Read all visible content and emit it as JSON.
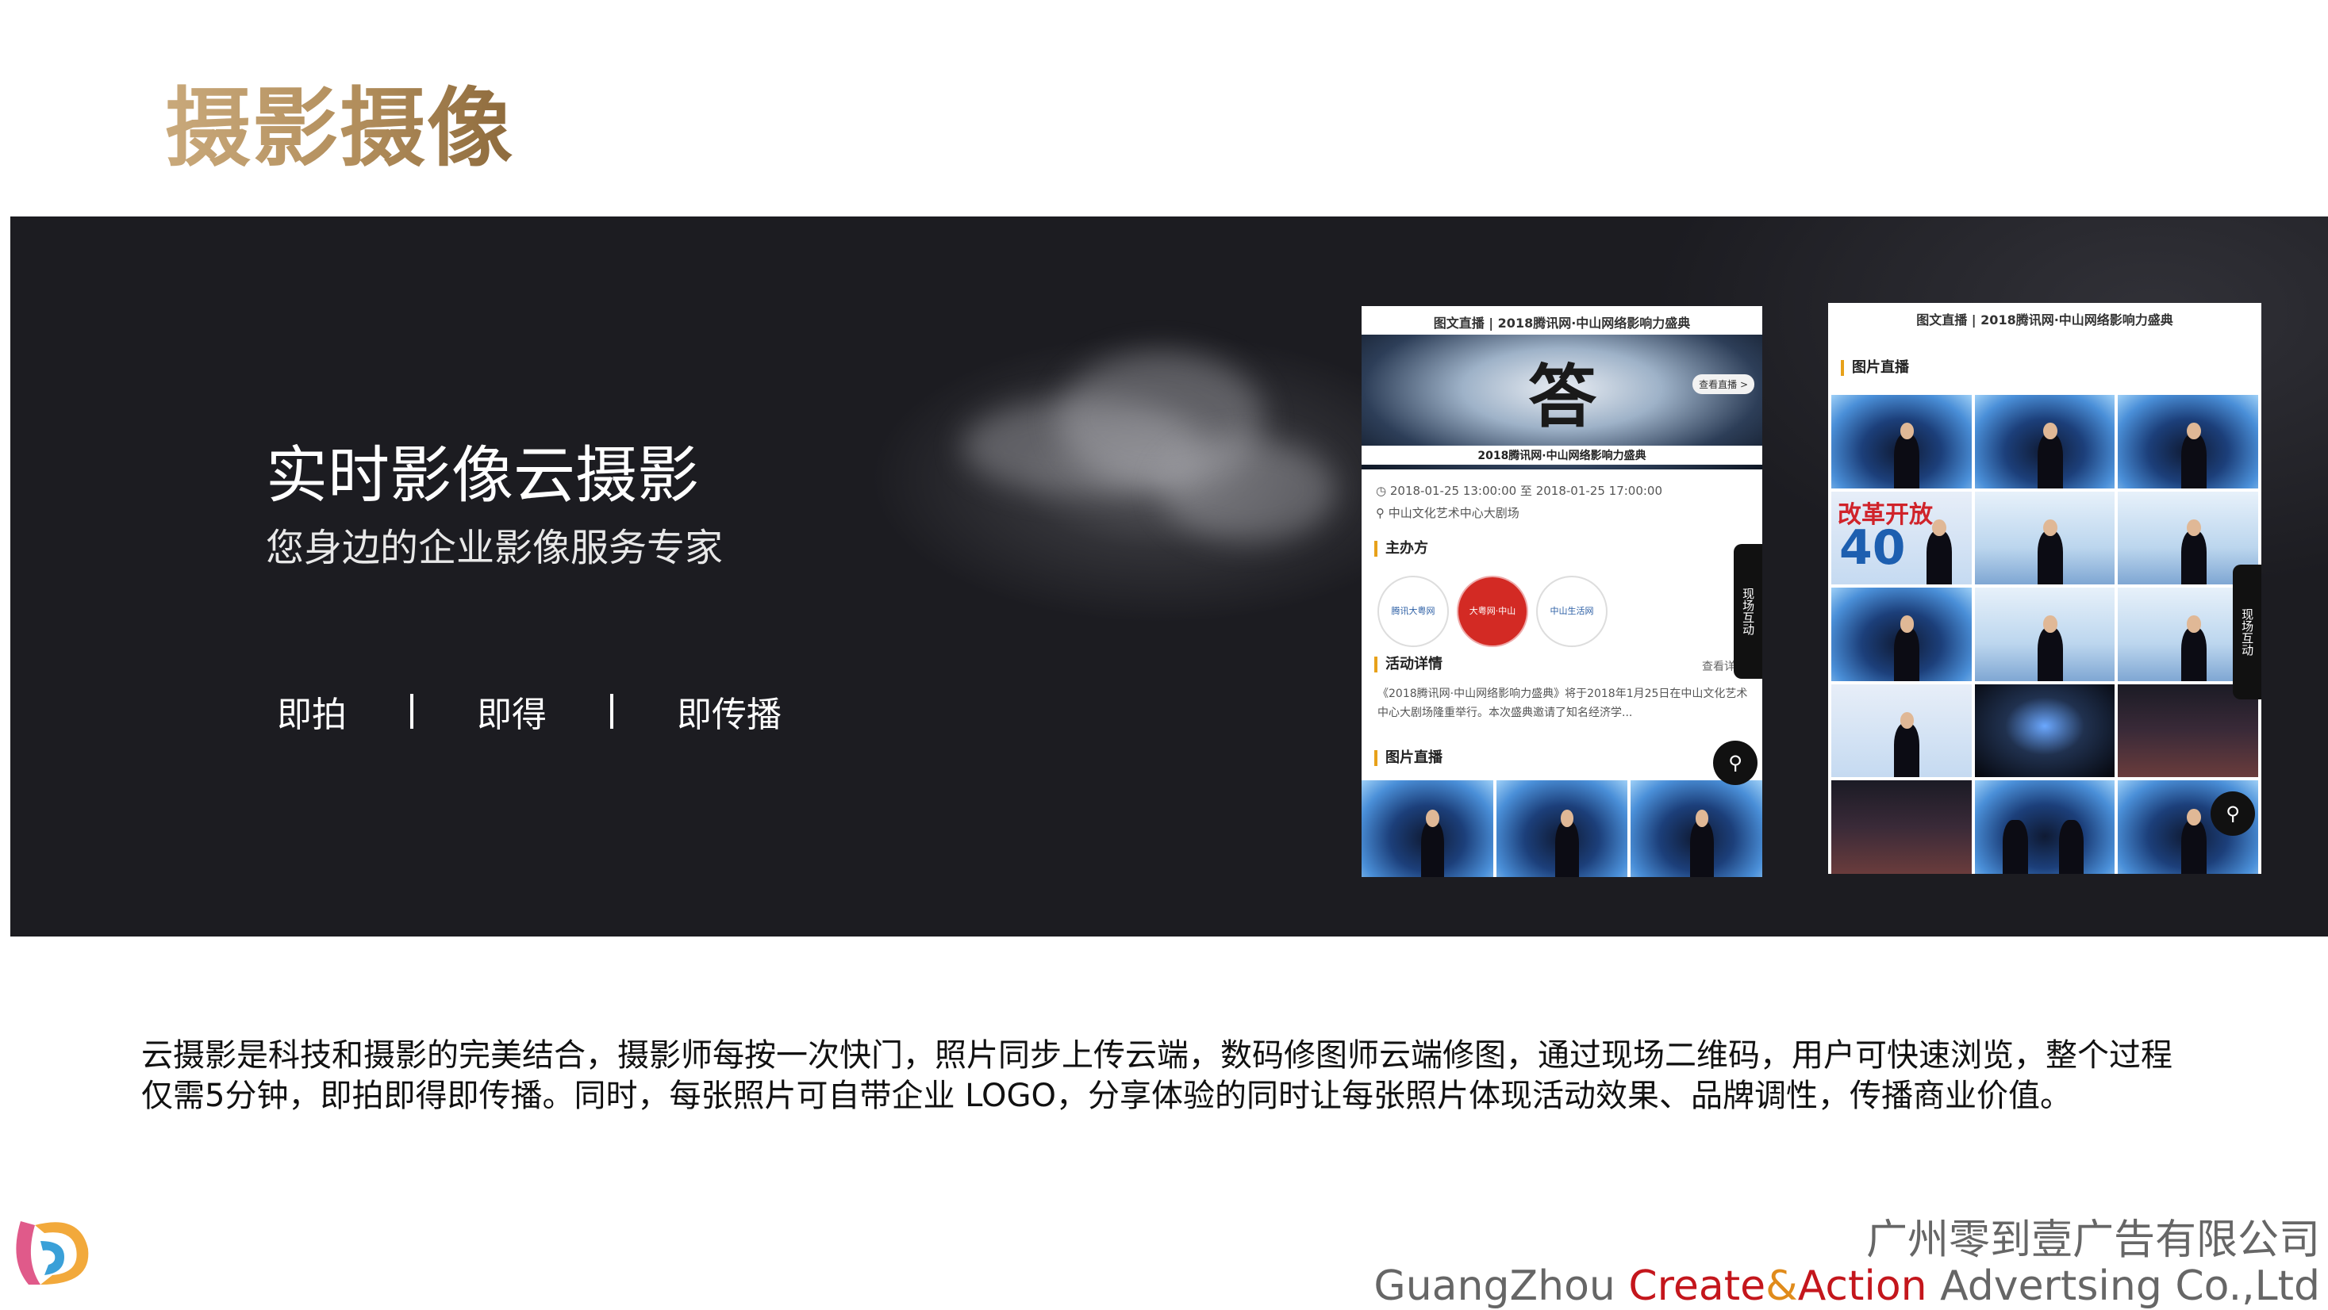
{
  "page_title": "摄影摄像",
  "banner": {
    "headline": "实时影像云摄影",
    "subtitle": "您身边的企业影像服务专家",
    "features": [
      "即拍",
      "即得",
      "即传播"
    ]
  },
  "phone_left": {
    "header": "图文直播 | 2018腾讯网·中山网络影响力盛典",
    "hero_button": "查看直播 >",
    "hero_caption": "2018腾讯网·中山网络影响力盛典",
    "time": "2018-01-25 13:00:00 至 2018-01-25 17:00:00",
    "location": "中山文化艺术中心大剧场",
    "organizer_title": "主办方",
    "organizers": [
      "腾讯大粤网",
      "大粤网·中山",
      "中山生活网"
    ],
    "details_title": "活动详情",
    "details_more": "查看详情",
    "details_text": "《2018腾讯网·中山网络影响力盛典》将于2018年1月25日在中山文化艺术中心大剧场隆重举行。本次盛典邀请了知名经济学...",
    "photo_title": "图片直播",
    "side_tab": "现场互动"
  },
  "phone_right": {
    "header": "图文直播 | 2018腾讯网·中山网络影响力盛典",
    "photo_title": "图片直播",
    "slide_text": "改革开放",
    "slide_number": "40",
    "side_tab": "现场互动"
  },
  "description": "云摄影是科技和摄影的完美结合，摄影师每按一次快门，照片同步上传云端，数码修图师云端修图，通过现场二维码，用户可快速浏览，整个过程仅需5分钟，即拍即得即传播。同时，每张照片可自带企业 LOGO，分享体验的同时让每张照片体现活动效果、品牌调性，传播商业价值。",
  "company": {
    "name_cn": "广州零到壹广告有限公司",
    "name_en_1": "GuangZhou ",
    "name_en_2": "Create",
    "name_en_3": "&",
    "name_en_4": "Action",
    "name_en_5": " Advertsing Co.,Ltd"
  },
  "colors": {
    "title_gold": "#b28e5c",
    "banner_bg": "#1c1c21",
    "brand_red": "#c4161c",
    "brand_orange": "#e08b1b",
    "accent_bar": "#e7a11a"
  }
}
